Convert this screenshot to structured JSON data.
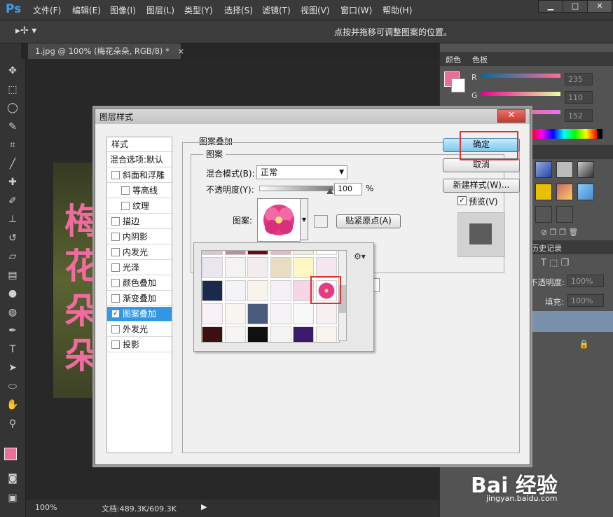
{
  "app": {
    "logo": "Ps"
  },
  "menu": [
    "文件(F)",
    "编辑(E)",
    "图像(I)",
    "图层(L)",
    "类型(Y)",
    "选择(S)",
    "滤镜(T)",
    "视图(V)",
    "窗口(W)",
    "帮助(H)"
  ],
  "window_buttons": [
    "▁",
    "□",
    "✕"
  ],
  "options_bar": {
    "hint": "点按并拖移可调整图案的位置。"
  },
  "document": {
    "tab_title": "1.jpg @ 100% (梅花朵朵, RGB/8) *",
    "close": "×",
    "chars": [
      "梅",
      "花",
      "朵",
      "朵"
    ]
  },
  "status": {
    "zoom": "100%",
    "doc_info": "文档:489.3K/609.3K"
  },
  "color_panel": {
    "tabs": [
      "颜色",
      "色板"
    ],
    "channels": [
      {
        "name": "R",
        "value": "235"
      },
      {
        "name": "G",
        "value": "110"
      },
      {
        "name": "B",
        "value": "152"
      }
    ],
    "foreground": "#eb6e98"
  },
  "layers_panel": {
    "title": "历史记录",
    "opacity_label": "不透明度:",
    "opacity_value": "100%",
    "fill_label": "填充:",
    "fill_value": "100%"
  },
  "dialog": {
    "title": "图层样式",
    "close": "✕",
    "styles_header": "样式",
    "blend_options": "混合选项:默认",
    "style_items": [
      {
        "label": "斜面和浮雕",
        "checked": false,
        "indent": false
      },
      {
        "label": "等高线",
        "checked": false,
        "indent": true
      },
      {
        "label": "纹理",
        "checked": false,
        "indent": true
      },
      {
        "label": "描边",
        "checked": false,
        "indent": false
      },
      {
        "label": "内阴影",
        "checked": false,
        "indent": false
      },
      {
        "label": "内发光",
        "checked": false,
        "indent": false
      },
      {
        "label": "光泽",
        "checked": false,
        "indent": false
      },
      {
        "label": "颜色叠加",
        "checked": false,
        "indent": false
      },
      {
        "label": "渐变叠加",
        "checked": false,
        "indent": false
      },
      {
        "label": "图案叠加",
        "checked": true,
        "indent": false
      },
      {
        "label": "外发光",
        "checked": false,
        "indent": false
      },
      {
        "label": "投影",
        "checked": false,
        "indent": false
      }
    ],
    "section_title": "图案叠加",
    "group_title": "图案",
    "blend_mode_label": "混合模式(B):",
    "blend_mode_value": "正常",
    "opacity_label": "不透明度(Y):",
    "opacity_value": "100",
    "opacity_unit": "%",
    "opacity_level": 1.0,
    "pattern_label": "图案:",
    "snap_button": "贴紧原点(A)",
    "ok_button": "确定",
    "cancel_button": "取消",
    "new_style_button": "新建样式(W)...",
    "preview_label": "预览(V)",
    "preview_checked": true
  },
  "watermark": {
    "brand": "Bai 经验",
    "url": "jingyan.baidu.com"
  }
}
